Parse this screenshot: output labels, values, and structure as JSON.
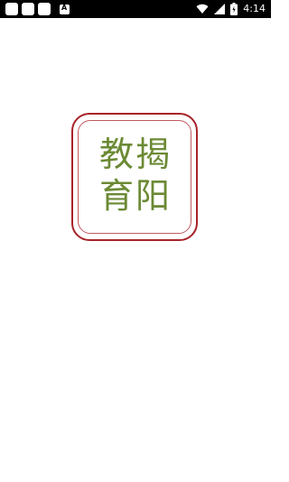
{
  "status_bar": {
    "time": "4:14",
    "notification_icons": [
      "app-icon",
      "app-icon",
      "app-icon",
      "a-icon"
    ],
    "a_icon_letter": "A",
    "system_icons": [
      "wifi-icon",
      "signal-icon",
      "battery-icon"
    ]
  },
  "logo": {
    "line1": "教揭",
    "line2": "育阳",
    "text_color": "#6b8a34",
    "border_color": "#a8232a"
  }
}
